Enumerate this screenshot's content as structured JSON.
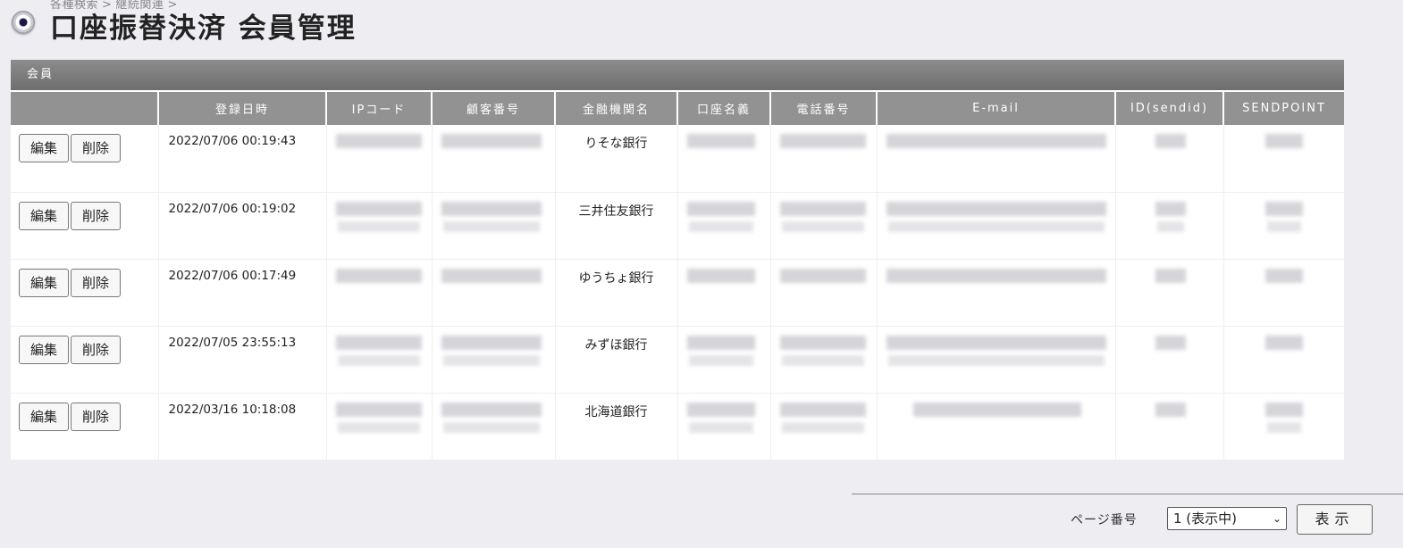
{
  "breadcrumb": [
    "各種検索",
    "継続関連"
  ],
  "breadcrumb_sep": ">",
  "page_title": "口座振替決済 会員管理",
  "section_label": "会員",
  "columns": [
    "",
    "登録日時",
    "IPコード",
    "顧客番号",
    "金融機関名",
    "口座名義",
    "電話番号",
    "E-mail",
    "ID(sendid)",
    "SENDPOINT"
  ],
  "buttons": {
    "edit": "編集",
    "delete": "削除"
  },
  "rows": [
    {
      "date": "2022/07/06 00:19:43",
      "bank": "りそな銀行"
    },
    {
      "date": "2022/07/06 00:19:02",
      "bank": "三井住友銀行"
    },
    {
      "date": "2022/07/06 00:17:49",
      "bank": "ゆうちょ銀行"
    },
    {
      "date": "2022/07/05 23:55:13",
      "bank": "みずほ銀行"
    },
    {
      "date": "2022/03/16 10:18:08",
      "bank": "北海道銀行"
    }
  ],
  "pager": {
    "label": "ページ番号",
    "selected": "1 (表示中)",
    "arrow": "⌄",
    "submit": "表示"
  },
  "colors": {
    "header_bg": "#929292",
    "section_bar": "#7a7a7a",
    "page_bg": "#eeedf2"
  }
}
